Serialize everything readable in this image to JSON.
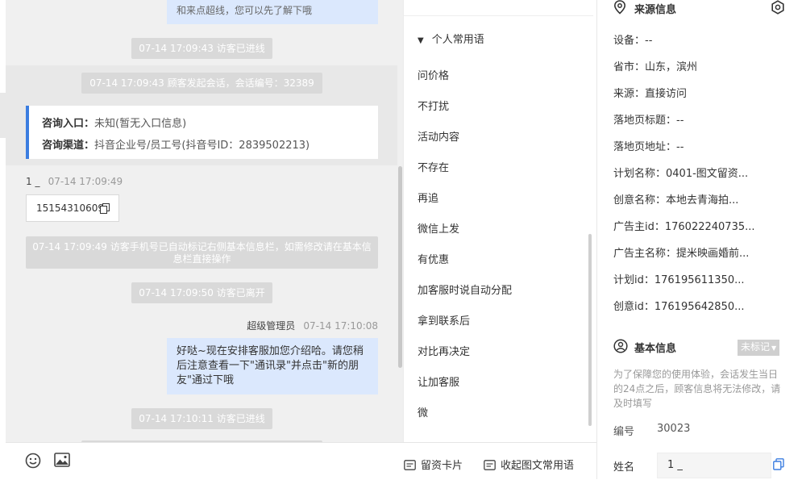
{
  "chat": {
    "top_bubble_text": "和来点超线，您可以先了解下哦",
    "msg1_system": "07-14 17:09:43 访客已进线",
    "msg2_system": "07-14 17:09:43 顾客发起会话，会话编号：32389",
    "info_card": {
      "entry_label": "咨询入口：",
      "entry_value": "未知(暂无入口信息)",
      "channel_label": "咨询渠道：",
      "channel_value": "抖音企业号/员工号(抖音号ID：2839502213)"
    },
    "visitor_name": "1 _",
    "visitor_time": "07-14 17:09:49",
    "visitor_phone": "15154310609",
    "msg3_system": "07-14 17:09:49 访客手机号已自动标记右侧基本信息栏，如需修改请在基本信息栏直接操作",
    "msg4_system": "07-14 17:09:50 访客已离开",
    "agent_name": "超级管理员",
    "agent_time": "07-14 17:10:08",
    "agent_message": "好哒~现在安排客服加您介绍哈。请您稍后注意查看一下\"通讯录\"并点击\"新的朋友\"通过下哦",
    "msg5_system": "07-14 17:10:11 访客已进线"
  },
  "toolbar": {
    "emoji_icon": "smile-icon",
    "image_icon": "image-icon",
    "card_label": "留资卡片",
    "collapse_label": "收起图文常用语"
  },
  "phrases": {
    "header": "个人常用语",
    "items": [
      "问价格",
      "不打扰",
      "活动内容",
      "不存在",
      "再追",
      "微信上发",
      "有优惠",
      "加客服时说自动分配",
      "拿到联系后",
      "对比再决定",
      "让加客服",
      "微"
    ]
  },
  "source": {
    "title": "来源信息",
    "fields": [
      "设备：--",
      "省市：山东，滨州",
      "来源：直接访问",
      "落地页标题：--",
      "落地页地址：--",
      "计划名称：0401-图文留资...",
      "创意名称：本地去青海拍...",
      "广告主id：176022240735...",
      "广告主名称：提米映画婚前...",
      "计划id：176195611350...",
      "创意id：176195642850..."
    ]
  },
  "basic": {
    "title": "基本信息",
    "tag_label": "未标记",
    "hint": "为了保障您的使用体验，会话发生当日的24点之后，顾客信息将无法修改，请及时填写",
    "id_label": "编号",
    "id_value": "30023",
    "name_label": "姓名",
    "name_value": "1 _"
  },
  "colors": {
    "accent": "#3b7de0",
    "agent_bubble": "#dbe8fd",
    "system_pill": "#d9d9d9"
  }
}
